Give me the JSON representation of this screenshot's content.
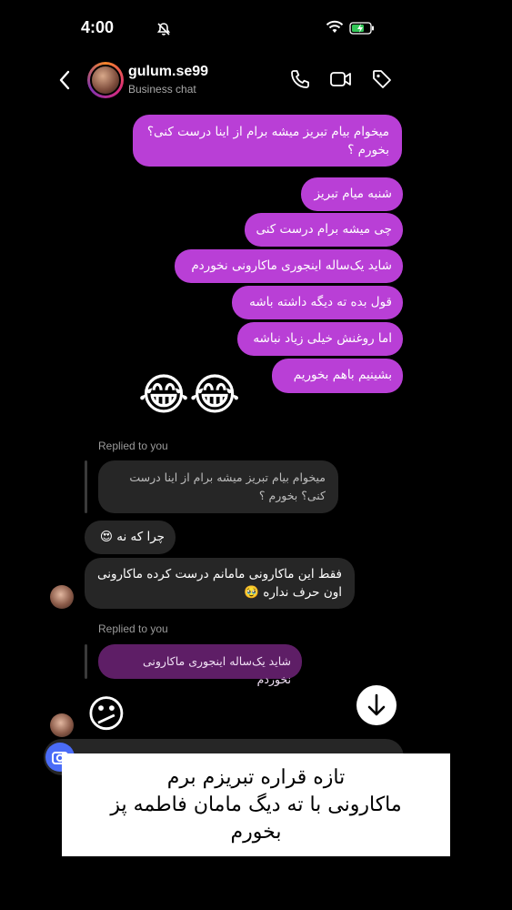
{
  "status_bar": {
    "time": "4:00"
  },
  "header": {
    "username": "gulum.se99",
    "subtitle": "Business chat"
  },
  "messages": {
    "sent1": "میخوام بیام تبریز میشه برام از اینا درست کنی؟ بخورم ؟",
    "sent2": "شنبه میام تبریز",
    "sent3": "چی میشه برام درست کنی",
    "sent4": "شاید یک‌ساله اینجوری ماکارونی نخوردم",
    "sent5": "قول بده ته دیگه داشته باشه",
    "sent6": "اما روغنش خیلی زیاد نباشه",
    "sent7": "بشینیم باهم بخوریم",
    "reaction_emojis": "😂😂",
    "replied1_label": "Replied to you",
    "quote1": "میخوام بیام تبریز میشه برام از اینا درست کنی؟ بخورم ؟",
    "recv1": "چرا که نه 😍",
    "recv2": "فقط این ماکارونی مامانم درست کرده ماکارونی اون حرف نداره 🥹",
    "replied2_label": "Replied to you",
    "quote2": "شاید یک‌ساله اینجوری ماکارونی نخوردم",
    "recv_emoji": "😕"
  },
  "caption": {
    "line1": "تازه قراره تبریزم برم",
    "line2": "ماکارونی با ته دیگ مامان فاطمه پز",
    "line3": "بخورم"
  },
  "colors": {
    "sent_bubble": "#b93fd6",
    "received_bubble": "#262626",
    "accent": "#4a6cf7"
  }
}
